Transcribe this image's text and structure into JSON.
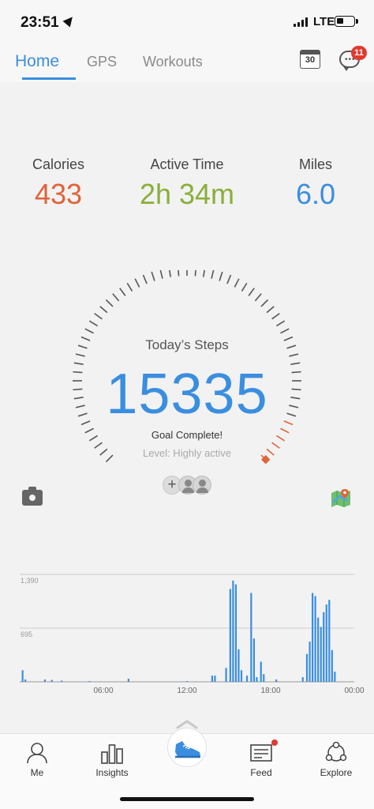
{
  "status_bar": {
    "time": "23:51",
    "network": "LTE"
  },
  "nav": {
    "tabs": [
      {
        "label": "Home",
        "active": true
      },
      {
        "label": "GPS",
        "active": false
      },
      {
        "label": "Workouts",
        "active": false
      }
    ],
    "calendar_day": "30",
    "messages_badge": "11",
    "accent_color": "#3a8ee0"
  },
  "stats": {
    "calories": {
      "label": "Calories",
      "value": "433",
      "color": "#e0633a"
    },
    "active_time": {
      "label": "Active Time",
      "value": "2h 34m",
      "color": "#8aae3a"
    },
    "miles": {
      "label": "Miles",
      "value": "6.0",
      "color": "#3a8ee0"
    }
  },
  "steps": {
    "title": "Today’s Steps",
    "value": "15335",
    "goal_status": "Goal Complete!",
    "level": "Level: Highly active"
  },
  "chart_data": {
    "type": "bar",
    "y_ticks": [
      "1,390",
      "695"
    ],
    "ylim": [
      0,
      1390
    ],
    "x_ticks": [
      "06:00",
      "12:00",
      "18:00",
      "00:00"
    ],
    "x_range_hours": [
      0,
      24
    ],
    "bars": [
      {
        "t": 0.2,
        "v": 150
      },
      {
        "t": 0.4,
        "v": 30
      },
      {
        "t": 1.8,
        "v": 30
      },
      {
        "t": 2.3,
        "v": 25
      },
      {
        "t": 3.0,
        "v": 15
      },
      {
        "t": 5.0,
        "v": 10
      },
      {
        "t": 7.8,
        "v": 40
      },
      {
        "t": 12.0,
        "v": 10
      },
      {
        "t": 13.8,
        "v": 80
      },
      {
        "t": 14.0,
        "v": 80
      },
      {
        "t": 14.8,
        "v": 180
      },
      {
        "t": 15.1,
        "v": 1200
      },
      {
        "t": 15.3,
        "v": 1310
      },
      {
        "t": 15.5,
        "v": 1260
      },
      {
        "t": 15.7,
        "v": 420
      },
      {
        "t": 15.9,
        "v": 150
      },
      {
        "t": 16.3,
        "v": 80
      },
      {
        "t": 16.6,
        "v": 1150
      },
      {
        "t": 16.8,
        "v": 560
      },
      {
        "t": 17.0,
        "v": 60
      },
      {
        "t": 17.3,
        "v": 260
      },
      {
        "t": 17.5,
        "v": 100
      },
      {
        "t": 18.4,
        "v": 30
      },
      {
        "t": 20.3,
        "v": 60
      },
      {
        "t": 20.6,
        "v": 360
      },
      {
        "t": 20.8,
        "v": 520
      },
      {
        "t": 21.0,
        "v": 1150
      },
      {
        "t": 21.2,
        "v": 1110
      },
      {
        "t": 21.4,
        "v": 830
      },
      {
        "t": 21.6,
        "v": 710
      },
      {
        "t": 21.8,
        "v": 900
      },
      {
        "t": 22.0,
        "v": 1000
      },
      {
        "t": 22.2,
        "v": 1060
      },
      {
        "t": 22.4,
        "v": 410
      },
      {
        "t": 22.6,
        "v": 130
      }
    ],
    "bar_color": "#3a8ee0"
  },
  "bottom_nav": {
    "items": [
      {
        "label": "Me",
        "icon": "person-icon"
      },
      {
        "label": "Insights",
        "icon": "bar-chart-icon"
      },
      {
        "label": "",
        "icon": "shoe-icon"
      },
      {
        "label": "Feed",
        "icon": "news-icon"
      },
      {
        "label": "Explore",
        "icon": "people-icon"
      }
    ]
  }
}
